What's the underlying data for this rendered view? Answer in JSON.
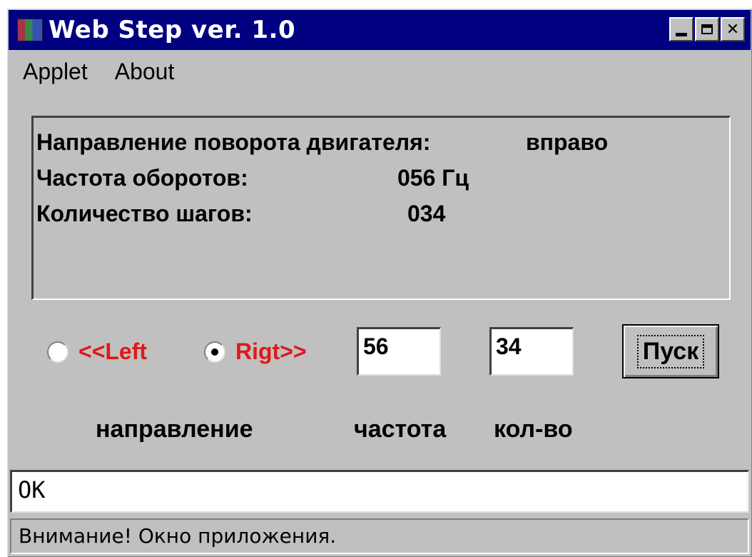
{
  "window": {
    "title": "Web Step ver. 1.0",
    "buttons": {
      "minimize": "minimize-icon",
      "maximize": "maximize-icon",
      "close": "✕"
    }
  },
  "menu": {
    "items": [
      "Applet",
      "About"
    ]
  },
  "info": {
    "direction_label": "Направление поворота двигателя:",
    "direction_value": "вправо",
    "frequency_label": "Частота оборотов:",
    "frequency_value": "056 Гц",
    "steps_label": "Количество шагов:",
    "steps_value": "034"
  },
  "controls": {
    "left_label": "<<Left",
    "right_label": "Rigt>>",
    "selected": "right",
    "frequency_input": "56",
    "steps_input": "34",
    "start_button": "Пуск"
  },
  "captions": {
    "direction": "направление",
    "frequency": "частота",
    "count": "кол-во"
  },
  "status_field": "OK",
  "status_bar": "Внимание! Окно приложения.",
  "colors": {
    "titlebar": "#000080",
    "radio_label": "#e01818",
    "face": "#c0c0c0"
  }
}
